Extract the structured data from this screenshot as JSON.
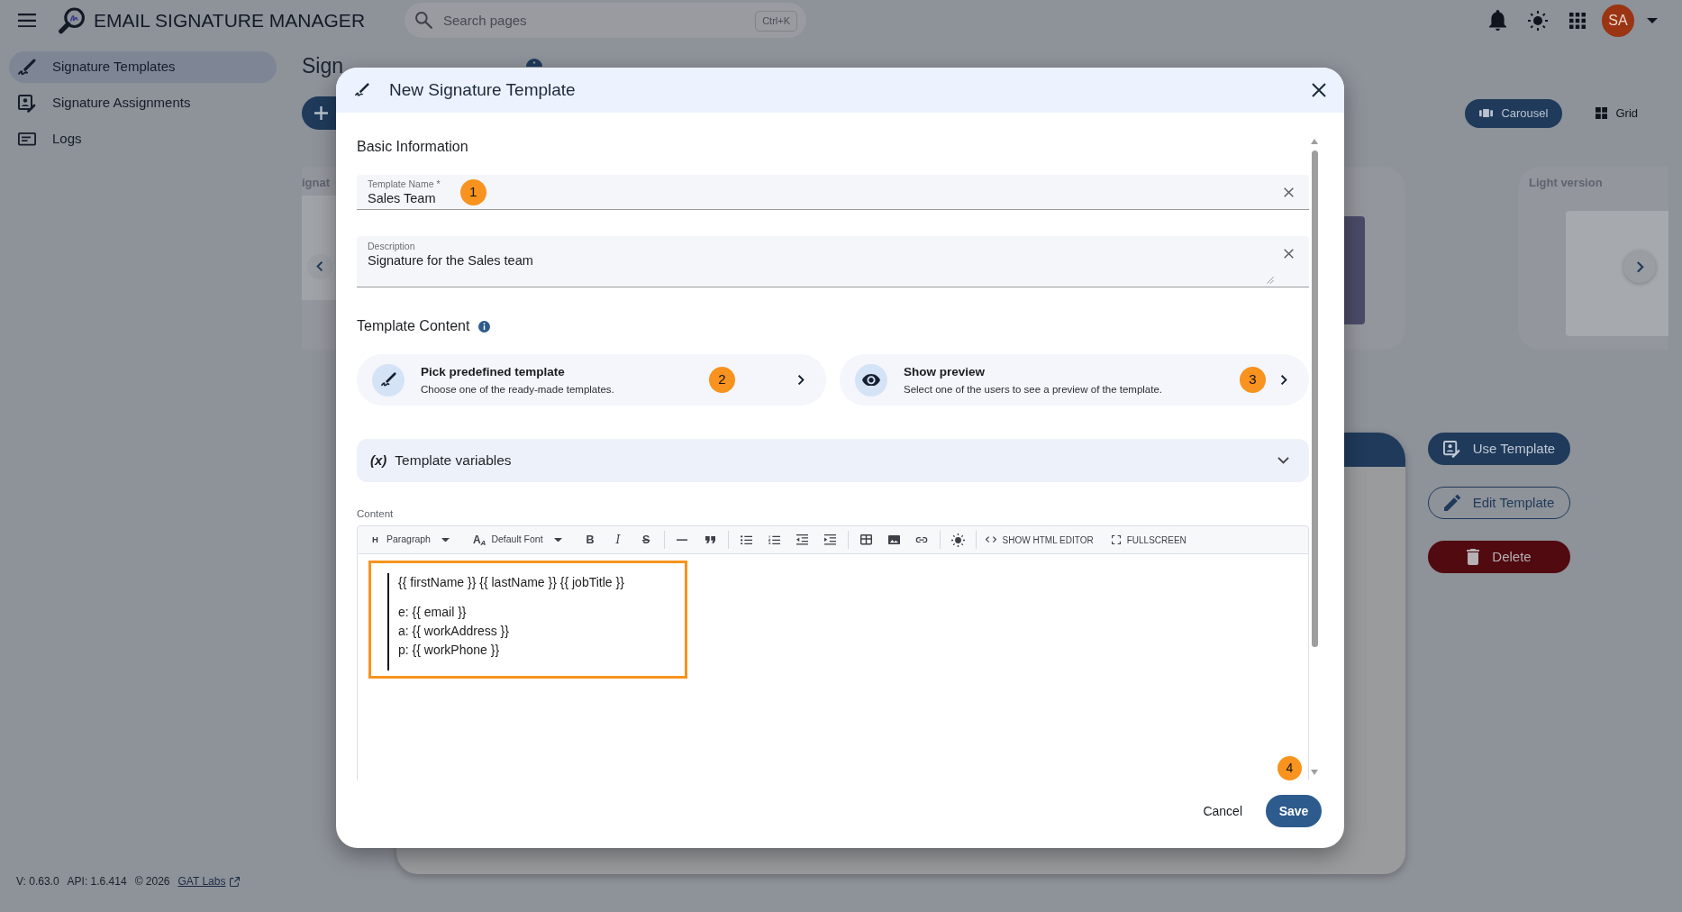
{
  "app_bar": {
    "title": "EMAIL SIGNATURE MANAGER",
    "search": {
      "placeholder": "Search pages",
      "shortcut": "Ctrl+K"
    },
    "avatar": "SA"
  },
  "sidebar": {
    "items": [
      {
        "label": "Signature Templates",
        "selected": true
      },
      {
        "label": "Signature Assignments",
        "selected": false
      },
      {
        "label": "Logs",
        "selected": false
      }
    ]
  },
  "footer": {
    "version": "V: 0.63.0",
    "api": "API: 1.6.414",
    "copyright": "© 2026",
    "link": "GAT Labs"
  },
  "page": {
    "heading": "Sign",
    "view_modes": [
      {
        "label": "Carousel",
        "selected": true
      },
      {
        "label": "Grid",
        "selected": false
      }
    ],
    "cards": [
      {
        "title": "ignat"
      },
      {
        "title": "Light version"
      }
    ],
    "actions": [
      {
        "label": "Use Template",
        "kind": "primary"
      },
      {
        "label": "Edit Template",
        "kind": "outline"
      },
      {
        "label": "Delete",
        "kind": "danger"
      }
    ]
  },
  "modal": {
    "title": "New Signature Template",
    "basic_information": {
      "heading": "Basic Information",
      "fields": [
        {
          "kind": "input",
          "label": "Template Name *",
          "value": "Sales Team",
          "step": "1"
        },
        {
          "kind": "textarea",
          "label": "Description",
          "value": "Signature for the Sales team"
        }
      ]
    },
    "template_content": {
      "heading": "Template Content",
      "options": [
        {
          "title": "Pick predefined template",
          "subtitle": "Choose one of the ready-made templates.",
          "step": "2"
        },
        {
          "title": "Show preview",
          "subtitle": "Select one of the users to see a preview of the template.",
          "step": "3"
        }
      ]
    },
    "variables": {
      "symbol": "(x)",
      "label": "Template variables",
      "expanded": false
    },
    "editor": {
      "label": "Content",
      "toolbar": {
        "heading_glyph": "H",
        "block_format": "Paragraph",
        "font_glyph": "A$_{A}$",
        "font": "Default Font",
        "bold": "B",
        "italic": "I",
        "strikethrough": "S",
        "html_editor": "SHOW HTML EDITOR",
        "fullscreen": "FULLSCREEN"
      },
      "paragraphs": [
        [
          "{{ firstName }} {{ lastName }} {{ jobTitle }}"
        ],
        [
          "e: {{ email }}",
          "a: {{ workAddress }}",
          "p: {{ workPhone }}"
        ]
      ],
      "highlighted": true,
      "step": "4"
    },
    "buttons": [
      {
        "label": "Cancel",
        "kind": "text"
      },
      {
        "label": "Save",
        "kind": "primary"
      }
    ]
  }
}
